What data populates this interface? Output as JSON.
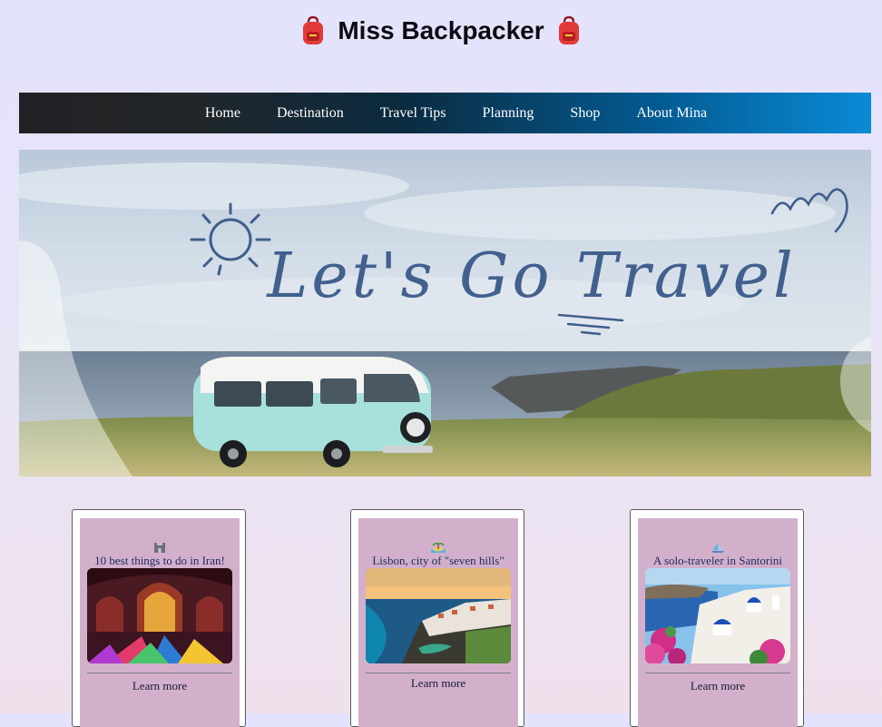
{
  "site": {
    "title": "Miss Backpacker",
    "left_icon": "backpack-icon",
    "right_icon": "backpack-icon"
  },
  "nav": {
    "items": [
      {
        "label": "Home"
      },
      {
        "label": "Destination"
      },
      {
        "label": "Travel Tips"
      },
      {
        "label": "Planning"
      },
      {
        "label": "Shop"
      },
      {
        "label": "About Mina"
      }
    ]
  },
  "hero": {
    "image_text": "Let's Go Travel"
  },
  "cards": [
    {
      "icon": "castle-icon",
      "title": "10 best things to do in Iran!",
      "link": "Learn more"
    },
    {
      "icon": "island-icon",
      "title": "Lisbon, city of \"seven hills\"",
      "link": "Learn more"
    },
    {
      "icon": "sailboat-icon",
      "title": "A solo-traveler in Santorini",
      "link": "Learn more"
    }
  ],
  "colors": {
    "background": "#e3e3fd",
    "nav_dark": "#202124",
    "nav_blue": "#0a8ad6",
    "card_fill": "#d2b0cc",
    "card_title": "#1b2a5a"
  }
}
